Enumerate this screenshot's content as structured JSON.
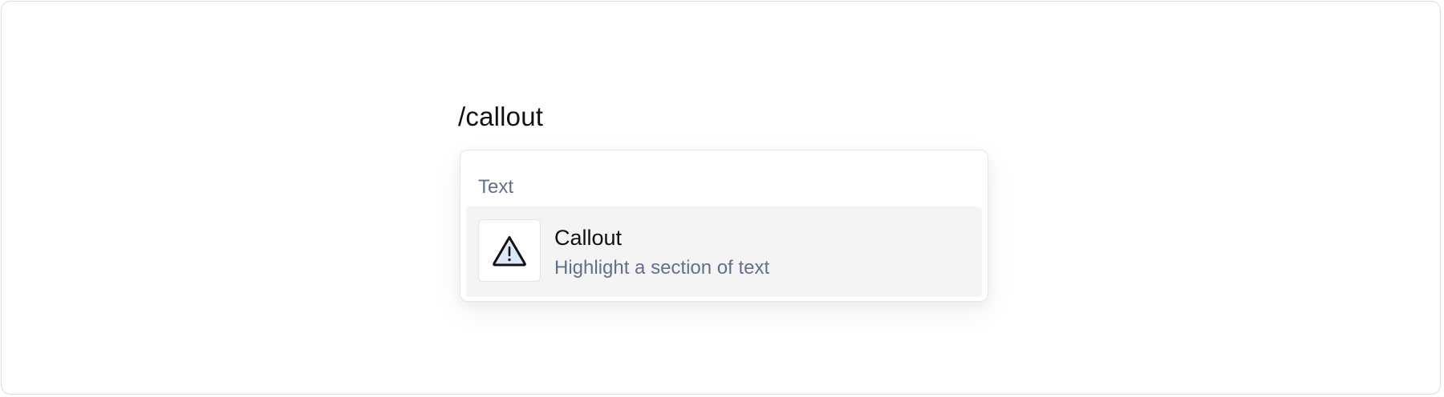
{
  "editor": {
    "typed_text": "/callout"
  },
  "menu": {
    "section_label": "Text",
    "items": [
      {
        "title": "Callout",
        "description": "Highlight a section of text",
        "icon": "warning-triangle-icon",
        "highlighted": true
      }
    ]
  },
  "colors": {
    "muted_text": "#64708a",
    "item_highlight_bg": "#f4f4f5",
    "icon_fill": "#dbe9f7"
  }
}
